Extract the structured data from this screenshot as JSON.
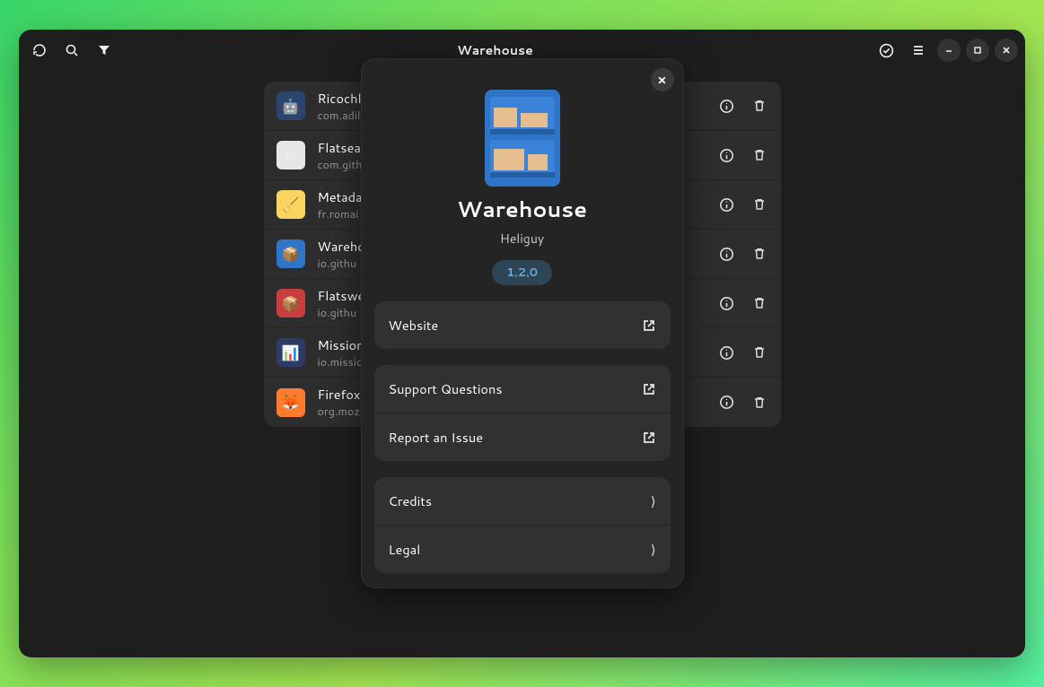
{
  "window": {
    "title": "Warehouse"
  },
  "apps": [
    {
      "name": "Ricochli",
      "id": "com.adilh",
      "icon_bg": "#2a466f",
      "icon_emoji": "🤖"
    },
    {
      "name": "Flatsea",
      "id": "com.gith",
      "icon_bg": "#e6e6e6",
      "icon_emoji": "⚙"
    },
    {
      "name": "Metada",
      "id": "fr.romai",
      "icon_bg": "#f7d560",
      "icon_emoji": "🧹"
    },
    {
      "name": "Wareho",
      "id": "io.githu",
      "icon_bg": "#2e74c7",
      "icon_emoji": "📦"
    },
    {
      "name": "Flatswe",
      "id": "io.githu",
      "icon_bg": "#c83d3d",
      "icon_emoji": "📦"
    },
    {
      "name": "Mission",
      "id": "io.missio",
      "icon_bg": "#2d3b66",
      "icon_emoji": "📊"
    },
    {
      "name": "Firefox",
      "id": "org.mozi",
      "icon_bg": "#ff7b2d",
      "icon_emoji": "🦊"
    }
  ],
  "about": {
    "app_name": "Warehouse",
    "author": "Heliguy",
    "version": "1.2.0",
    "links": {
      "website": "Website",
      "support": "Support Questions",
      "issue": "Report an Issue",
      "credits": "Credits",
      "legal": "Legal"
    }
  }
}
